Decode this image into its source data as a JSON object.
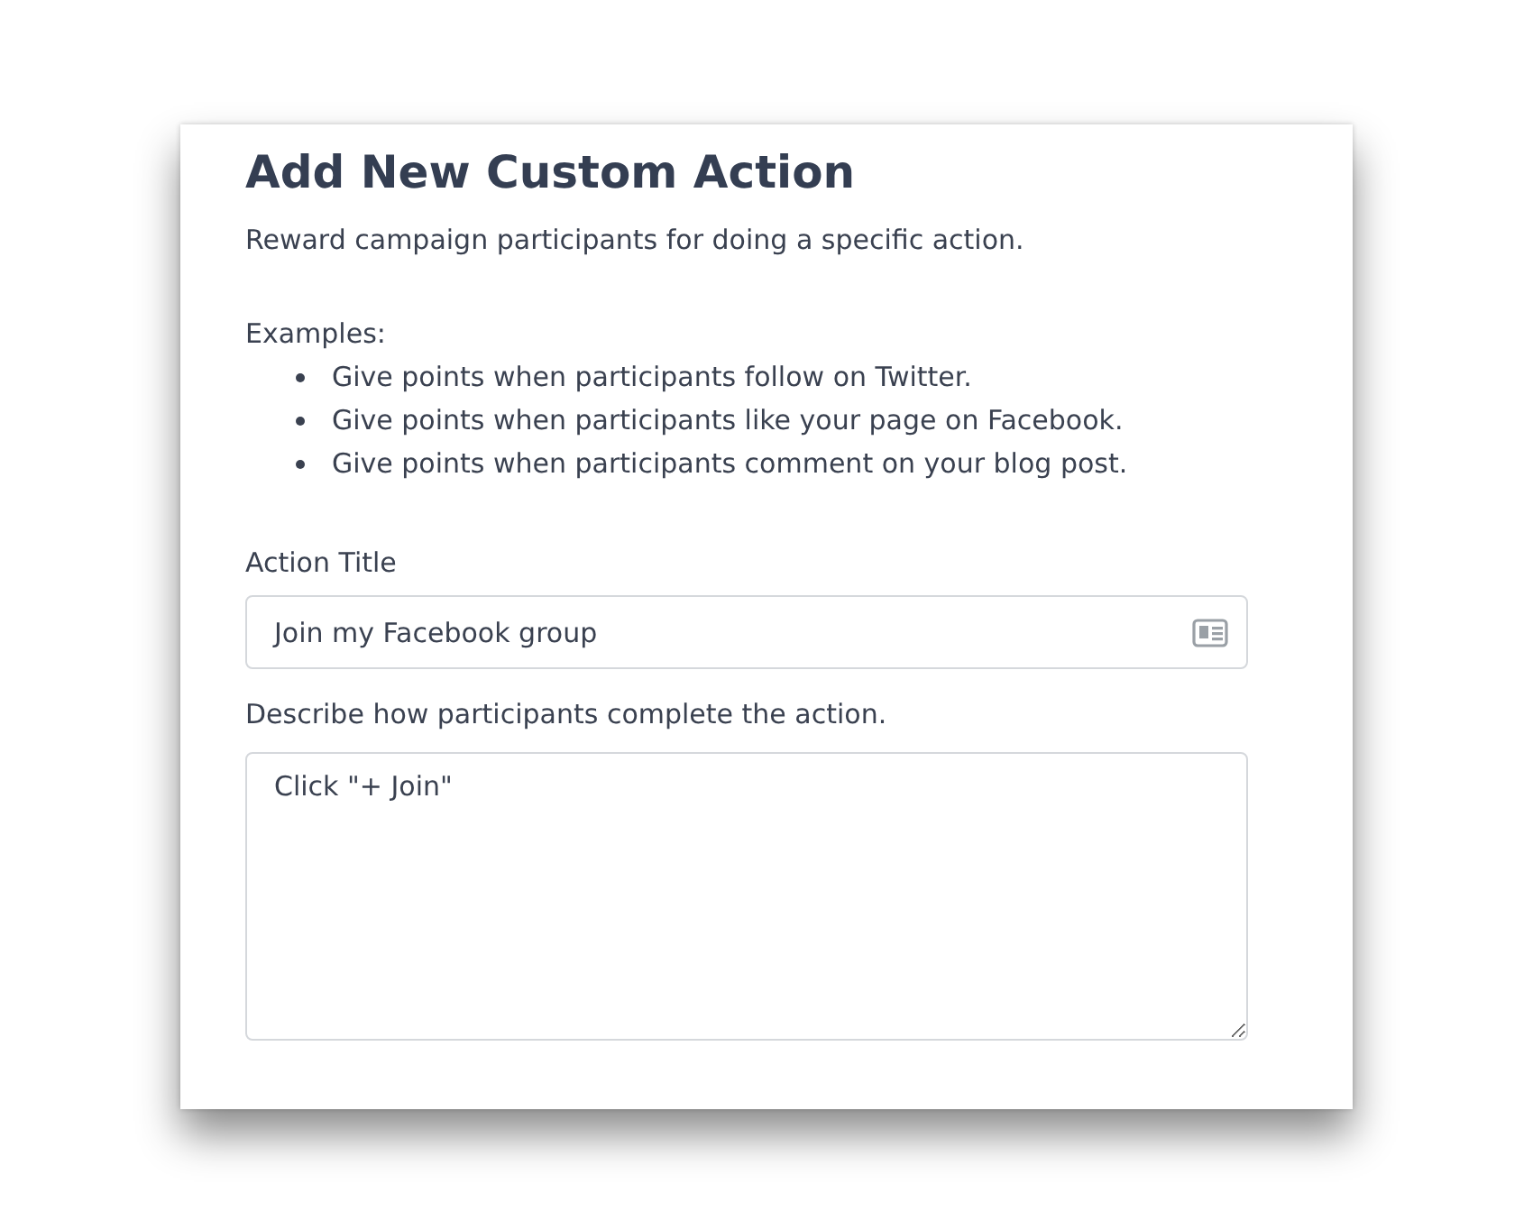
{
  "title": "Add New Custom Action",
  "subtitle": "Reward campaign participants for doing a specific action.",
  "examples_label": "Examples:",
  "examples": [
    "Give points when participants follow on Twitter.",
    "Give points when participants like your page on Facebook.",
    "Give points when participants comment on your blog post."
  ],
  "action_title": {
    "label": "Action Title",
    "value": "Join my Facebook group"
  },
  "description": {
    "label": "Describe how participants complete the action.",
    "value": "Click \"+ Join\""
  }
}
